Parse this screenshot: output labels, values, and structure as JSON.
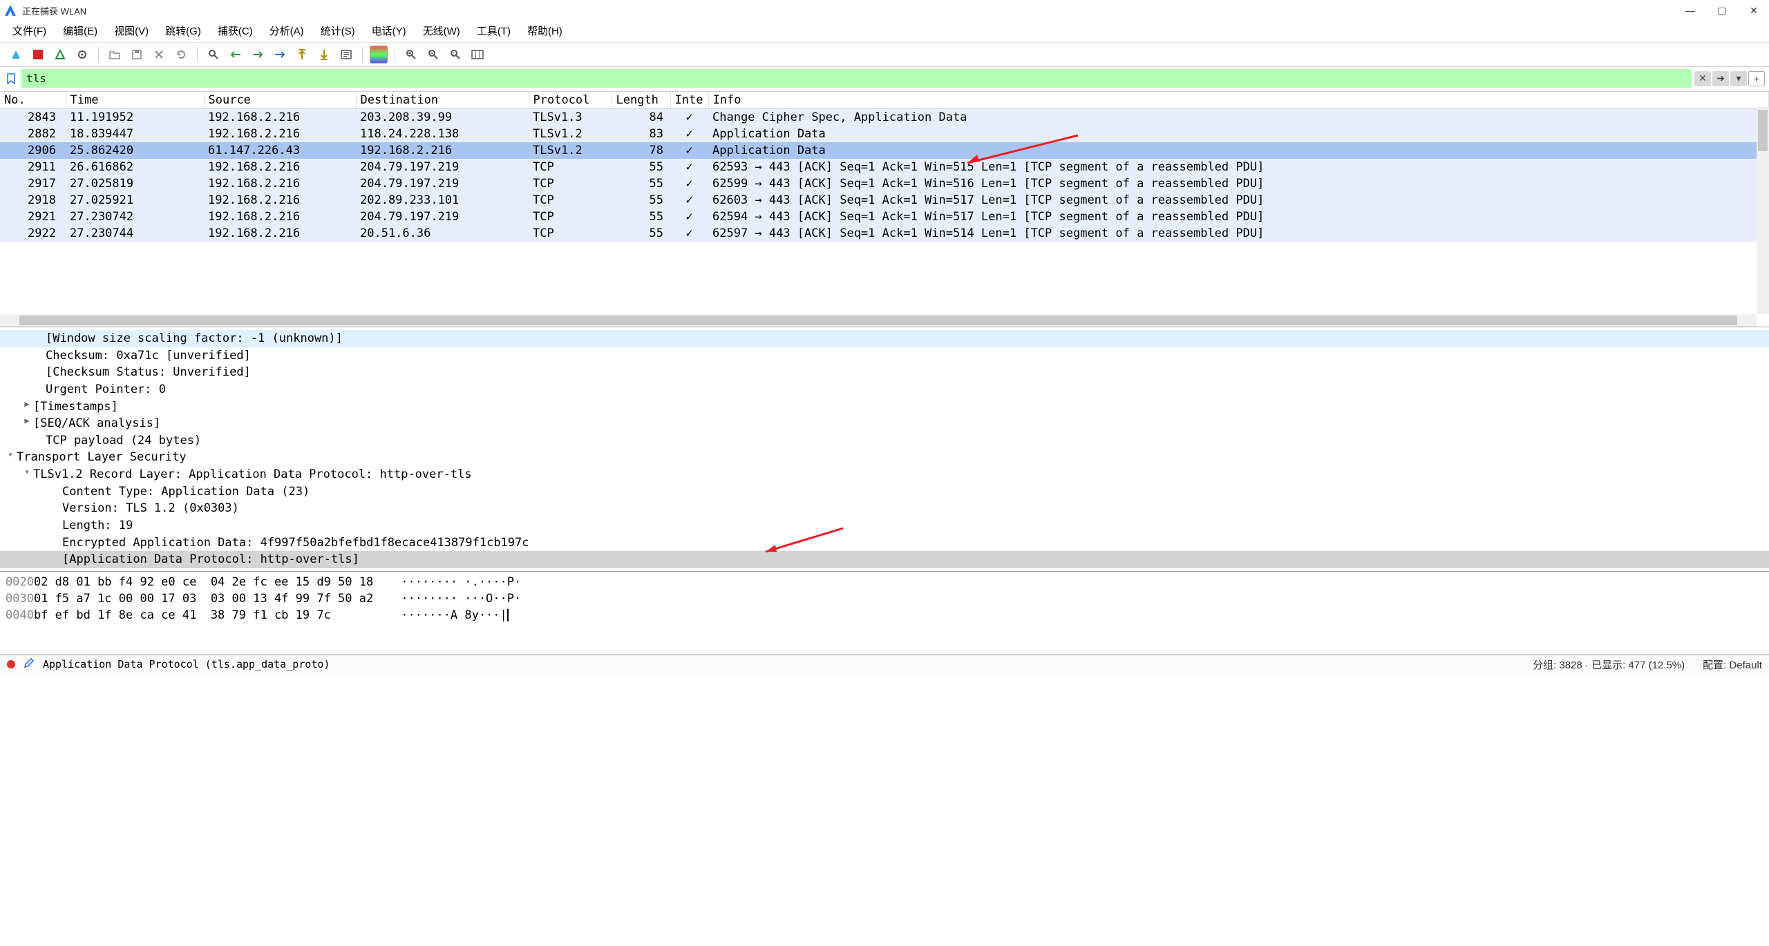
{
  "window": {
    "title": "正在捕获 WLAN",
    "min": "—",
    "max": "▢",
    "close": "✕"
  },
  "menu": {
    "items": [
      "文件(F)",
      "编辑(E)",
      "视图(V)",
      "跳转(G)",
      "捕获(C)",
      "分析(A)",
      "统计(S)",
      "电话(Y)",
      "无线(W)",
      "工具(T)",
      "帮助(H)"
    ]
  },
  "filter": {
    "value": "tls",
    "clear": "✕",
    "dropdown": "▾",
    "plus": "+"
  },
  "columns": [
    "No.",
    "Time",
    "Source",
    "Destination",
    "Protocol",
    "Length",
    "Inte",
    "Info"
  ],
  "packets": [
    {
      "no": "2843",
      "time": "11.191952",
      "src": "192.168.2.216",
      "dst": "203.208.39.99",
      "proto": "TLSv1.3",
      "len": "84",
      "inte": "✓",
      "info": "Change Cipher Spec, Application Data",
      "cls": "app"
    },
    {
      "no": "2882",
      "time": "18.839447",
      "src": "192.168.2.216",
      "dst": "118.24.228.138",
      "proto": "TLSv1.2",
      "len": "83",
      "inte": "✓",
      "info": "Application Data",
      "cls": "app"
    },
    {
      "no": "2906",
      "time": "25.862420",
      "src": "61.147.226.43",
      "dst": "192.168.2.216",
      "proto": "TLSv1.2",
      "len": "78",
      "inte": "✓",
      "info": "Application Data",
      "cls": "sel"
    },
    {
      "no": "2911",
      "time": "26.616862",
      "src": "192.168.2.216",
      "dst": "204.79.197.219",
      "proto": "TCP",
      "len": "55",
      "inte": "✓",
      "info": "62593 → 443 [ACK] Seq=1 Ack=1 Win=515 Len=1 [TCP segment of a reassembled PDU]",
      "cls": "app"
    },
    {
      "no": "2917",
      "time": "27.025819",
      "src": "192.168.2.216",
      "dst": "204.79.197.219",
      "proto": "TCP",
      "len": "55",
      "inte": "✓",
      "info": "62599 → 443 [ACK] Seq=1 Ack=1 Win=516 Len=1 [TCP segment of a reassembled PDU]",
      "cls": "app"
    },
    {
      "no": "2918",
      "time": "27.025921",
      "src": "192.168.2.216",
      "dst": "202.89.233.101",
      "proto": "TCP",
      "len": "55",
      "inte": "✓",
      "info": "62603 → 443 [ACK] Seq=1 Ack=1 Win=517 Len=1 [TCP segment of a reassembled PDU]",
      "cls": "app"
    },
    {
      "no": "2921",
      "time": "27.230742",
      "src": "192.168.2.216",
      "dst": "204.79.197.219",
      "proto": "TCP",
      "len": "55",
      "inte": "✓",
      "info": "62594 → 443 [ACK] Seq=1 Ack=1 Win=517 Len=1 [TCP segment of a reassembled PDU]",
      "cls": "app"
    },
    {
      "no": "2922",
      "time": "27.230744",
      "src": "192.168.2.216",
      "dst": "20.51.6.36",
      "proto": "TCP",
      "len": "55",
      "inte": "✓",
      "info": "62597 → 443 [ACK] Seq=1 Ack=1 Win=514 Len=1 [TCP segment of a reassembled PDU]",
      "cls": "app"
    }
  ],
  "tree": {
    "l0": "[Window size scaling factor: -1 (unknown)]",
    "l1": "Checksum: 0xa71c [unverified]",
    "l2": "[Checksum Status: Unverified]",
    "l3": "Urgent Pointer: 0",
    "l4": "[Timestamps]",
    "l5": "[SEQ/ACK analysis]",
    "l6": "TCP payload (24 bytes)",
    "l7": "Transport Layer Security",
    "l8": "TLSv1.2 Record Layer: Application Data Protocol: http-over-tls",
    "l9": "Content Type: Application Data (23)",
    "l10": "Version: TLS 1.2 (0x0303)",
    "l11": "Length: 19",
    "l12": "Encrypted Application Data: 4f997f50a2bfefbd1f8ecace413879f1cb197c",
    "l13": "[Application Data Protocol: http-over-tls]"
  },
  "hex": {
    "rows": [
      {
        "off": "0020",
        "b": "02 d8 01 bb f4 92 e0 ce  04 2e fc ee 15 d9 50 18",
        "a": "········ ·.····P·"
      },
      {
        "off": "0030",
        "b": "01 f5 a7 1c 00 00 17 03  03 00 13 4f 99 7f 50 a2",
        "a": "········ ···O··P·"
      },
      {
        "off": "0040",
        "b": "bf ef bd 1f 8e ca ce 41  38 79 f1 cb 19 7c",
        "a": "·······A 8y···|"
      }
    ]
  },
  "status": {
    "left": "Application Data Protocol (tls.app_data_proto)",
    "packets": "分组: 3828 · 已显示: 477 (12.5%)",
    "profile": "配置: Default"
  }
}
